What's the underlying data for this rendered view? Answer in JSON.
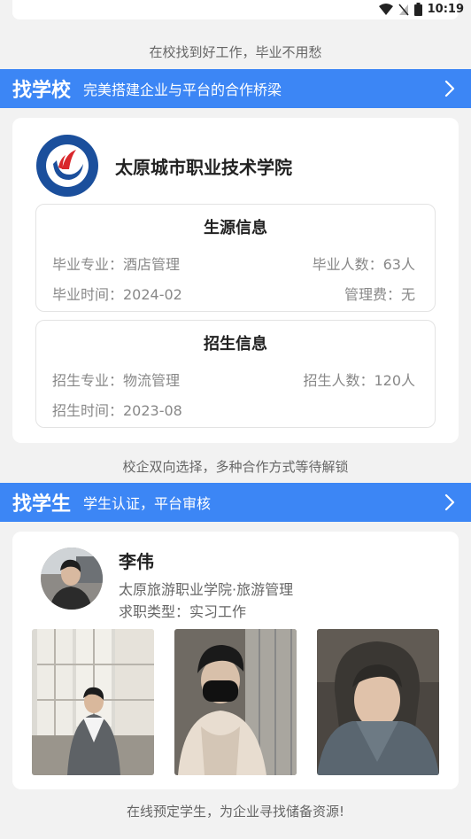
{
  "status_bar": {
    "time": "10:19"
  },
  "taglines": {
    "top": "在校找到好工作，毕业不用愁",
    "middle": "校企双向选择，多种合作方式等待解锁",
    "bottom": "在线预定学生，为企业寻找储备资源!"
  },
  "find_school": {
    "title": "找学校",
    "subtitle": "完美搭建企业与平台的合作桥梁",
    "school_name": "太原城市职业技术学院",
    "source_info": {
      "heading": "生源信息",
      "major": "毕业专业：酒店管理",
      "grad_count": "毕业人数：63人",
      "grad_time": "毕业时间：2024-02",
      "fee": "管理费：无"
    },
    "enroll_info": {
      "heading": "招生信息",
      "major": "招生专业：物流管理",
      "count": "招生人数：120人",
      "time": "招生时间：2023-08"
    }
  },
  "find_student": {
    "title": "找学生",
    "subtitle": "学生认证，平台审核",
    "name": "李伟",
    "school_major": "太原旅游职业学院·旅游管理",
    "job_type": "求职类型：实习工作"
  },
  "colors": {
    "accent": "#3c86f5",
    "card": "#ffffff",
    "background": "#f2f2f2"
  }
}
